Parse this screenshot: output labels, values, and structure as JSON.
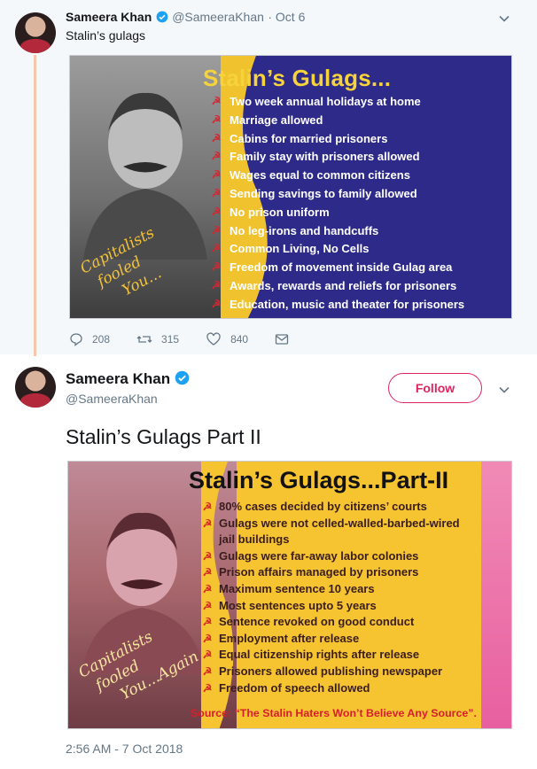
{
  "parent_tweet": {
    "name": "Sameera Khan",
    "handle": "@SameeraKhan",
    "date": "· Oct 6",
    "text": "Stalin’s gulags",
    "card": {
      "title": "Stalin’s Gulags...",
      "items": [
        "Two week annual holidays at home",
        "Marriage allowed",
        "Cabins for married prisoners",
        "Family stay with prisoners allowed",
        "Wages equal to common citizens",
        "Sending savings to family allowed",
        "No prison uniform",
        "No leg-irons and handcuffs",
        "Common Living, No Cells",
        "Freedom of movement inside Gulag area",
        "Awards, rewards and reliefs for prisoners",
        "Education, music and theater for prisoners"
      ],
      "script_lines": [
        "Capitalists",
        "fooled",
        "You..."
      ]
    },
    "actions": {
      "reply_count": "208",
      "retweet_count": "315",
      "like_count": "840"
    }
  },
  "main_tweet": {
    "name": "Sameera Khan",
    "handle": "@SameeraKhan",
    "follow_label": "Follow",
    "text": "Stalin’s Gulags Part II",
    "card": {
      "title": "Stalin’s Gulags...Part-II",
      "items": [
        "80% cases decided by citizens’ courts",
        "Gulags were not celled-walled-barbed-wired",
        "jail buildings",
        "Gulags were far-away labor colonies",
        "Prison affairs managed by prisoners",
        "Maximum sentence 10 years",
        "Most sentences upto 5 years",
        "Sentence revoked on good conduct",
        "Employment after release",
        "Equal citizenship rights after release",
        "Prisoners allowed publishing newspaper",
        "Freedom of speech allowed"
      ],
      "script_lines": [
        "Capitalists",
        "fooled",
        "You...Again"
      ],
      "source": "Source: “The Stalin Haters Won’t Believe Any Source”."
    },
    "timestamp": "2:56 AM - 7 Oct 2018"
  },
  "icons": {
    "verified": "verified-badge-icon",
    "reply": "reply-icon",
    "retweet": "retweet-icon",
    "like": "heart-icon",
    "dm": "envelope-icon",
    "more": "chevron-down-icon",
    "bullet": "hammer-sickle-icon"
  },
  "colors": {
    "accent_blue": "#1da1f2",
    "follow_red": "#e0245e",
    "card1_bg": "#2d2a8a",
    "card1_title": "#f7d33b",
    "card2_bg": "#f6c431",
    "source_red": "#d71f2b"
  }
}
